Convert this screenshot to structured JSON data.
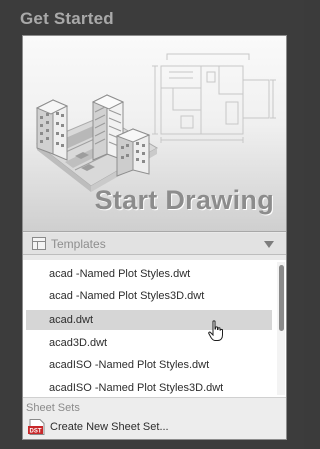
{
  "header": {
    "title": "Get Started"
  },
  "start_tile": {
    "label": "Start Drawing",
    "icon": "city-illustration-icon"
  },
  "templates": {
    "label": "Templates",
    "icon": "templates-grid-icon",
    "dropdown_icon": "chevron-down-icon",
    "items": [
      {
        "label": "acad -Named Plot Styles.dwt",
        "selected": false
      },
      {
        "label": "acad -Named Plot Styles3D.dwt",
        "selected": false
      },
      {
        "label": "acad.dwt",
        "selected": true
      },
      {
        "label": "acad3D.dwt",
        "selected": false
      },
      {
        "label": "acadISO -Named Plot Styles.dwt",
        "selected": false
      },
      {
        "label": "acadISO -Named Plot Styles3D.dwt",
        "selected": false
      }
    ]
  },
  "sheet_sets": {
    "label": "Sheet Sets",
    "create_label": "Create New Sheet Set...",
    "file_icon_text": "DST"
  },
  "colors": {
    "background": "#3c3c3c",
    "panel": "#e9e9e9",
    "selection": "#d6d6d6",
    "dst_red": "#c8282a"
  }
}
